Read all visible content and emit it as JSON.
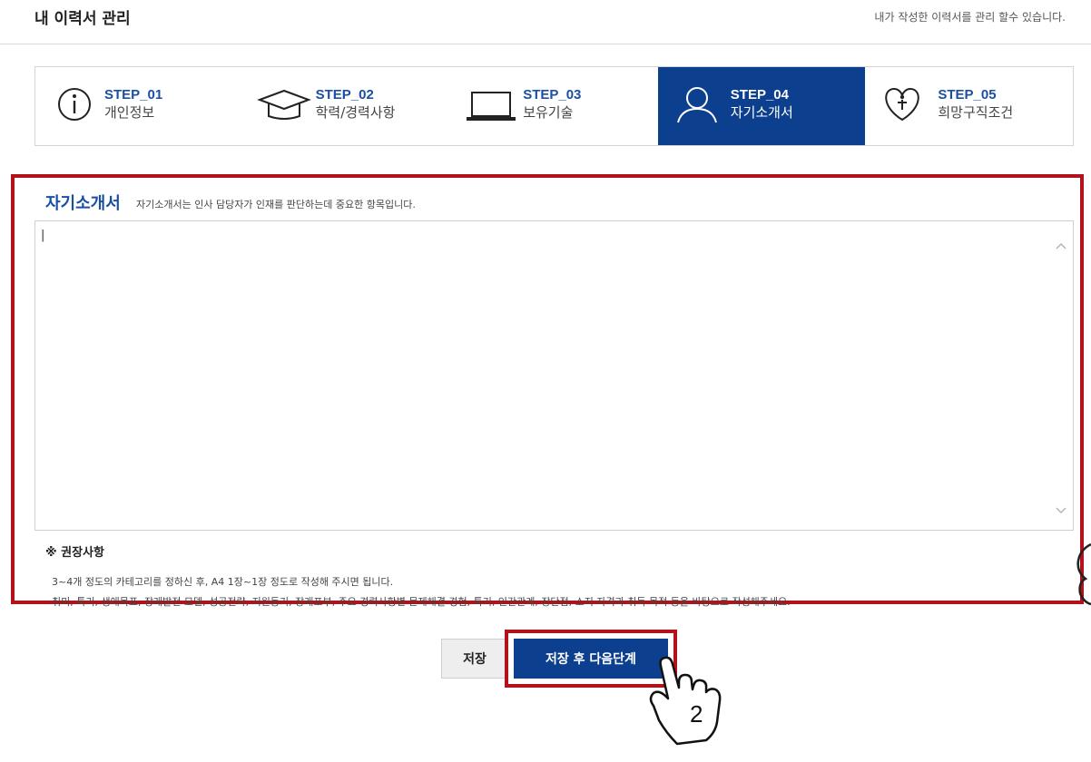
{
  "header": {
    "title": "내 이력서 관리",
    "description": "내가 작성한 이력서를 관리 할수 있습니다."
  },
  "steps": [
    {
      "code": "STEP_01",
      "name": "개인정보",
      "icon": "info-circle-icon",
      "active": false
    },
    {
      "code": "STEP_02",
      "name": "학력/경력사항",
      "icon": "graduation-cap-icon",
      "active": false
    },
    {
      "code": "STEP_03",
      "name": "보유기술",
      "icon": "laptop-icon",
      "active": false
    },
    {
      "code": "STEP_04",
      "name": "자기소개서",
      "icon": "user-icon",
      "active": true
    },
    {
      "code": "STEP_05",
      "name": "희망구직조건",
      "icon": "heart-person-icon",
      "active": false
    }
  ],
  "section": {
    "title": "자기소개서",
    "subtitle": "자기소개서는 인사 담당자가 인재를 판단하는데 중요한 항목입니다.",
    "textarea_value": ""
  },
  "recommend": {
    "title": "※ 권장사항",
    "lines": [
      "3~4개 정도의 카테고리를 정하신 후, A4 1장~1장 정도로 작성해 주시면 됩니다.",
      "취미, 특기, 생애목표, 장래발전 모델, 성공전략, 지원동기, 장래포부, 주요 경력사항별 문제해결 경험, 특기, 인간관계, 장단점, 소지 자격과 취득 목적 등을 바탕으로 작성해주세요."
    ]
  },
  "buttons": {
    "save": "저장",
    "save_next": "저장 후 다음단계"
  },
  "annotation": {
    "step_number": "2"
  },
  "colors": {
    "brand": "#0d3f8f",
    "highlight": "#b3121b"
  }
}
